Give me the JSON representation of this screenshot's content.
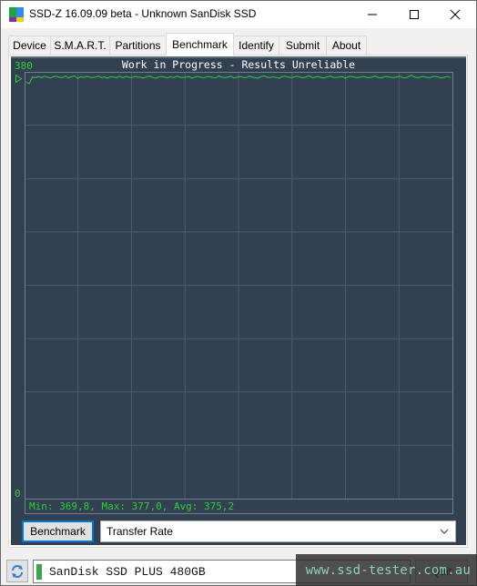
{
  "window": {
    "title": "SSD-Z 16.09.09 beta - Unknown SanDisk SSD",
    "icon": "app-icon",
    "icon_colors": [
      "#1fa43a",
      "#2f8cff",
      "#7a2fb0",
      "#f4d000"
    ],
    "controls": {
      "minimize": "minimize-icon",
      "maximize": "maximize-icon",
      "close": "close-icon"
    }
  },
  "tabs": [
    {
      "label": "Device",
      "active": false
    },
    {
      "label": "S.M.A.R.T.",
      "active": false
    },
    {
      "label": "Partitions",
      "active": false
    },
    {
      "label": "Benchmark",
      "active": true
    },
    {
      "label": "Identify",
      "active": false
    },
    {
      "label": "Submit",
      "active": false
    },
    {
      "label": "About",
      "active": false
    }
  ],
  "benchmark": {
    "button_label": "Benchmark",
    "mode_select_value": "Transfer Rate",
    "start_marker": "play-marker-icon"
  },
  "colors": {
    "graph_background": "#324152",
    "grid_line": "#4b5a6b",
    "trace": "#2ecc40",
    "label_green": "#33cc33",
    "title_text": "#ffffff"
  },
  "chart_data": {
    "type": "line",
    "title": "Work in Progress - Results Unreliable",
    "ylabel": "",
    "xlabel": "",
    "ylim": [
      0,
      380
    ],
    "y_tick_labels": [
      "380",
      "0"
    ],
    "grid": true,
    "grid_divisions": {
      "x": 8,
      "y": 8
    },
    "stats_text": "Min: 369,8, Max: 377,0, Avg: 375,2",
    "stats": {
      "min": 369.8,
      "max": 377.0,
      "avg": 375.2
    },
    "series": [
      {
        "name": "Transfer Rate",
        "values": [
          370.5,
          369.8,
          375.5,
          374.8,
          375.9,
          375.0,
          376.1,
          375.2,
          374.6,
          375.8,
          376.0,
          375.1,
          374.9,
          376.3,
          374.7,
          375.6,
          376.4,
          374.2,
          375.7,
          375.0,
          376.0,
          375.3,
          374.9,
          375.4,
          376.2,
          374.8,
          375.5,
          374.5,
          375.9,
          375.3,
          375.0,
          376.1,
          374.7,
          375.8,
          375.2,
          374.9,
          376.0,
          375.4,
          375.1,
          374.6,
          375.7,
          376.2,
          375.0,
          374.3,
          375.5,
          375.9,
          375.2,
          374.8,
          375.6,
          375.0,
          376.1,
          375.3,
          374.9,
          375.4,
          375.8,
          374.5,
          375.2,
          376.0,
          375.1,
          374.8,
          375.6,
          375.9,
          375.0,
          374.7,
          376.3,
          375.2,
          374.9,
          375.5,
          376.0,
          374.6,
          375.3,
          375.8,
          375.1,
          374.8,
          376.2,
          375.4,
          375.0,
          374.5,
          375.7,
          376.4,
          375.2,
          374.9,
          375.6,
          375.0,
          374.3,
          375.8,
          376.1,
          375.3,
          374.9,
          375.5,
          376.0,
          375.2,
          374.7,
          375.6,
          376.5,
          374.8,
          375.3,
          375.9,
          375.0,
          374.6,
          375.7,
          376.2,
          375.1,
          374.9,
          375.5,
          375.8,
          374.4,
          375.6,
          376.0,
          375.2,
          374.9,
          375.4,
          375.9,
          375.1,
          374.8,
          375.5,
          376.3,
          375.0,
          374.7,
          375.6,
          375.9,
          375.2,
          374.9,
          375.4,
          376.1,
          375.0,
          374.6,
          375.7,
          377.0,
          375.3,
          374.8,
          375.5,
          375.9,
          375.1,
          374.9,
          375.6,
          376.0,
          375.2,
          374.5,
          375.4,
          375.8,
          375.0
        ]
      }
    ]
  },
  "bottom_bar": {
    "refresh_icon": "refresh-icon",
    "drive_name": "SanDisk SSD PLUS 480GB",
    "drive_status_color": "#3aa54a",
    "quit_label": "Quit",
    "watermark": "www.ssd-tester.com.au"
  }
}
